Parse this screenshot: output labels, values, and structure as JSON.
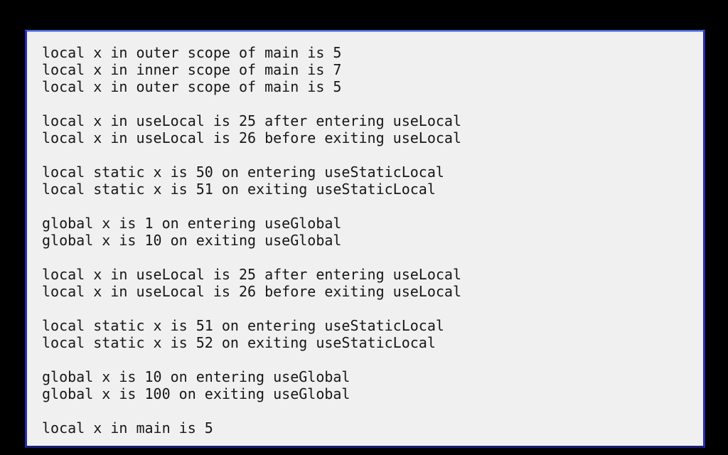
{
  "window": {
    "type": "console-output-window",
    "background_color": "#f0f0f0",
    "border_color": "#2a2ab4",
    "desktop_color": "#000000",
    "text_color": "#171717"
  },
  "console": {
    "lines": [
      "local x in outer scope of main is 5",
      "local x in inner scope of main is 7",
      "local x in outer scope of main is 5",
      "",
      "local x in useLocal is 25 after entering useLocal",
      "local x in useLocal is 26 before exiting useLocal",
      "",
      "local static x is 50 on entering useStaticLocal",
      "local static x is 51 on exiting useStaticLocal",
      "",
      "global x is 1 on entering useGlobal",
      "global x is 10 on exiting useGlobal",
      "",
      "local x in useLocal is 25 after entering useLocal",
      "local x in useLocal is 26 before exiting useLocal",
      "",
      "local static x is 51 on entering useStaticLocal",
      "local static x is 52 on exiting useStaticLocal",
      "",
      "global x is 10 on entering useGlobal",
      "global x is 100 on exiting useGlobal",
      "",
      "local x in main is 5"
    ]
  }
}
